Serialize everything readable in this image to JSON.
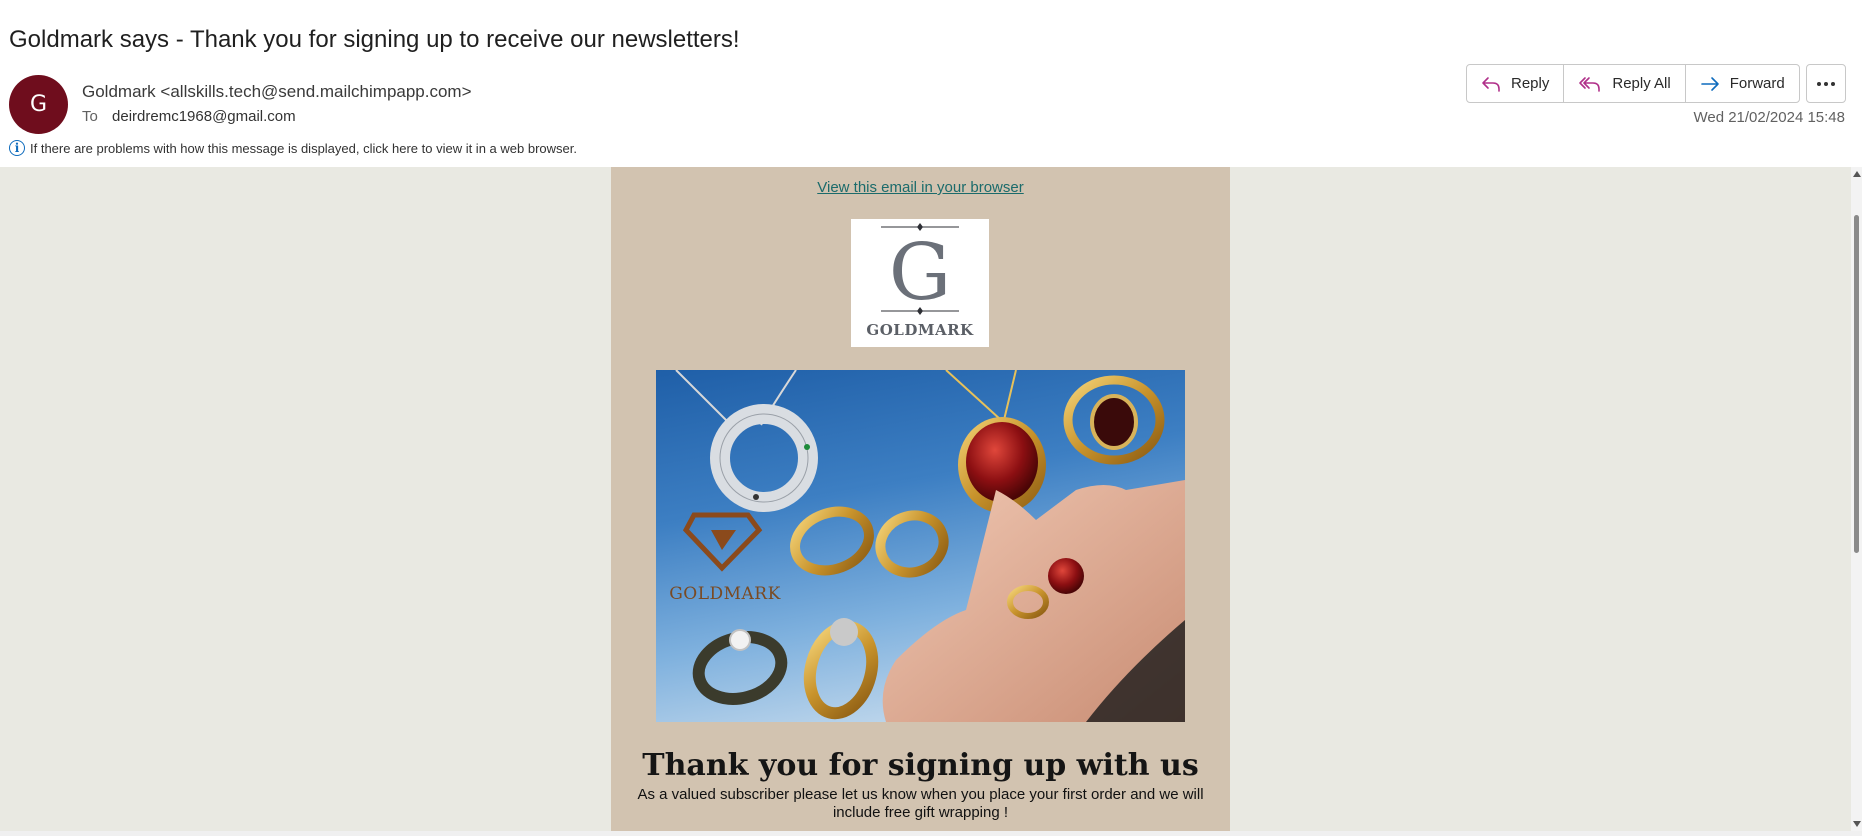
{
  "subject": "Goldmark says - Thank you for signing up to receive our newsletters!",
  "sender": {
    "avatar_initial": "G",
    "avatar_color": "#6f0d1d",
    "from": "Goldmark <allskills.tech@send.mailchimpapp.com>",
    "to_label": "To",
    "to_address": "deirdremc1968@gmail.com"
  },
  "actions": {
    "reply": "Reply",
    "reply_all": "Reply All",
    "forward": "Forward",
    "more_icon": "more-horizontal-icon"
  },
  "date": "Wed 21/02/2024 15:48",
  "infobar": {
    "icon": "info-icon",
    "text": "If there are problems with how this message is displayed, click here to view it in a web browser."
  },
  "email": {
    "view_link": "View this email in your browser",
    "logo_letter": "G",
    "logo_word": "GOLDMARK",
    "hero_brand": "GOLDMARK",
    "heading": "Thank you for signing up with us",
    "subtext": "As a valued subscriber please let us know when you place your first order and we will include free gift wrapping !"
  },
  "colors": {
    "email_bg": "#d2c3b0",
    "page_bg": "#e9e9e2",
    "link": "#1b6b6b",
    "reply_icon": "#b0318a",
    "forward_icon": "#0f6cbd"
  }
}
